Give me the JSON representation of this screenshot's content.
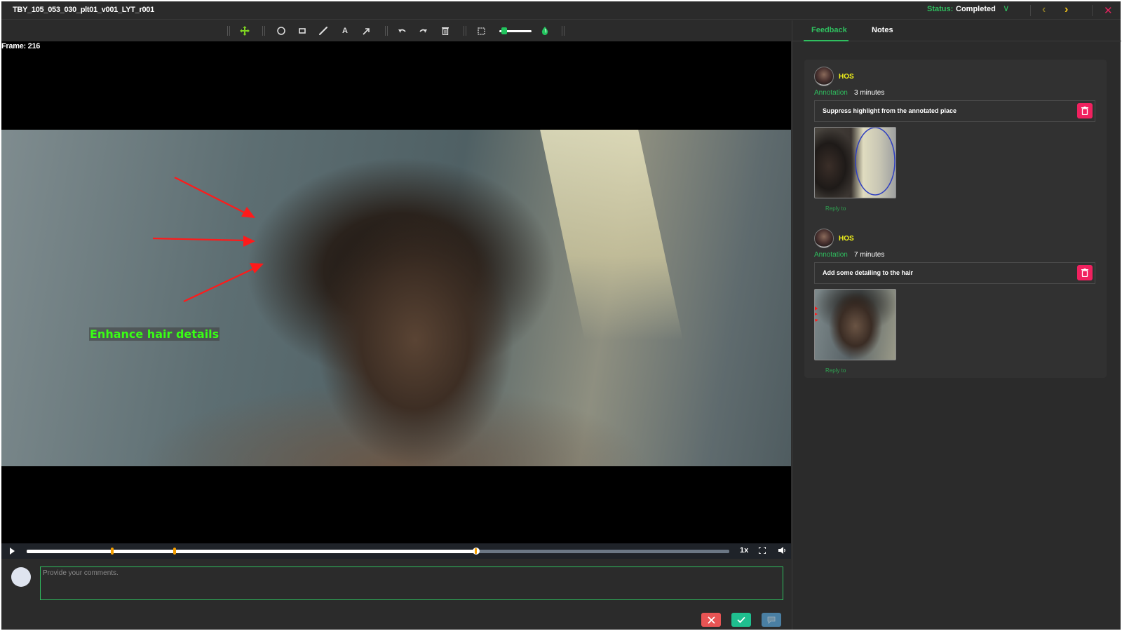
{
  "header": {
    "title": "TBY_105_053_030_plt01_v001_LYT_r001",
    "status_label": "Status:",
    "status_value": "Completed",
    "status_dropdown_glyph": "∨",
    "prev_glyph": "‹",
    "next_glyph": "›",
    "close_glyph": "✕"
  },
  "toolbar": {
    "tools": [
      "move-icon",
      "circle-icon",
      "rectangle-icon",
      "pencil-icon",
      "text-icon",
      "arrow-icon",
      "undo-icon",
      "redo-icon",
      "trash-icon",
      "selection-icon",
      "brush-size-slider",
      "color-picker-icon"
    ],
    "text_tool_glyph": "A",
    "brush_size_fraction": 0.1,
    "accent_color": "#22c55e"
  },
  "viewer": {
    "frame_label": "Frame: 216",
    "annotation_text": "Enhance hair details",
    "annotation_text_color": "#39ff14",
    "arrow_color": "#ff1a1a"
  },
  "playback": {
    "progress_fraction": 0.64,
    "markers_fraction": [
      0.122,
      0.211
    ],
    "speed": "1x"
  },
  "comment": {
    "placeholder": "Provide your comments.",
    "value": ""
  },
  "actions": {
    "reject_glyph": "✕",
    "approve_glyph": "✓"
  },
  "panel": {
    "tabs": [
      {
        "label": "Feedback",
        "active": true
      },
      {
        "label": "Notes",
        "active": false
      }
    ],
    "entries": [
      {
        "author": "HOS",
        "kind": "Annotation",
        "age": "3 minutes",
        "message": "Suppress highlight from the annotated place",
        "reply_label": "Reply to"
      },
      {
        "author": "HOS",
        "kind": "Annotation",
        "age": "7 minutes",
        "message": "Add some detailing to the hair",
        "reply_label": "Reply to"
      }
    ]
  },
  "colors": {
    "accent_green": "#2fbf5f",
    "author_yellow": "#f5f51a",
    "delete_pink": "#f0215f",
    "reject_red": "#e85454",
    "approve_teal": "#1fbf8f",
    "comment_blue": "#4a7fa3"
  }
}
